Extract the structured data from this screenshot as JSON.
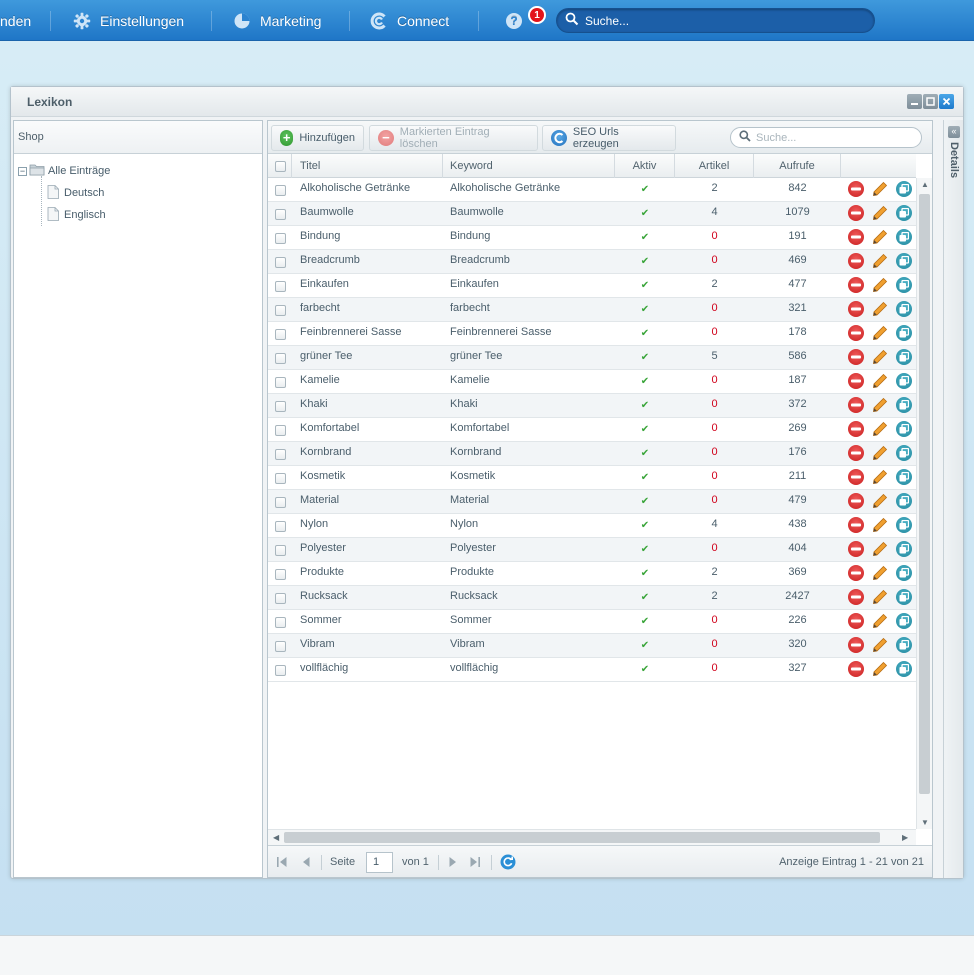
{
  "topbar": {
    "partial_label": "nden",
    "settings_label": "Einstellungen",
    "marketing_label": "Marketing",
    "connect_label": "Connect",
    "help_badge": "1",
    "search_placeholder": "Suche..."
  },
  "window": {
    "title": "Lexikon"
  },
  "left": {
    "header": "Shop",
    "tree": {
      "root": "Alle Einträge",
      "children": [
        "Deutsch",
        "Englisch"
      ]
    }
  },
  "toolbar": {
    "add_label": "Hinzufügen",
    "delete_label": "Markierten Eintrag löschen",
    "seo_label": "SEO Urls erzeugen",
    "search_placeholder": "Suche..."
  },
  "columns": {
    "title": "Titel",
    "keyword": "Keyword",
    "active": "Aktiv",
    "articles": "Artikel",
    "views": "Aufrufe"
  },
  "rows": [
    {
      "title": "Alkoholische Getränke",
      "keyword": "Alkoholische Getränke",
      "active": "✔",
      "articles": "2",
      "views": "842"
    },
    {
      "title": "Baumwolle",
      "keyword": "Baumwolle",
      "active": "✔",
      "articles": "4",
      "views": "1079"
    },
    {
      "title": "Bindung",
      "keyword": "Bindung",
      "active": "✔",
      "articles": "0",
      "views": "191"
    },
    {
      "title": "Breadcrumb",
      "keyword": "Breadcrumb",
      "active": "✔",
      "articles": "0",
      "views": "469"
    },
    {
      "title": "Einkaufen",
      "keyword": "Einkaufen",
      "active": "✔",
      "articles": "2",
      "views": "477"
    },
    {
      "title": "farbecht",
      "keyword": "farbecht",
      "active": "✔",
      "articles": "0",
      "views": "321"
    },
    {
      "title": "Feinbrennerei Sasse",
      "keyword": "Feinbrennerei Sasse",
      "active": "✔",
      "articles": "0",
      "views": "178"
    },
    {
      "title": "grüner Tee",
      "keyword": "grüner Tee",
      "active": "✔",
      "articles": "5",
      "views": "586"
    },
    {
      "title": "Kamelie",
      "keyword": "Kamelie",
      "active": "✔",
      "articles": "0",
      "views": "187"
    },
    {
      "title": "Khaki",
      "keyword": "Khaki",
      "active": "✔",
      "articles": "0",
      "views": "372"
    },
    {
      "title": "Komfortabel",
      "keyword": "Komfortabel",
      "active": "✔",
      "articles": "0",
      "views": "269"
    },
    {
      "title": "Kornbrand",
      "keyword": "Kornbrand",
      "active": "✔",
      "articles": "0",
      "views": "176"
    },
    {
      "title": "Kosmetik",
      "keyword": "Kosmetik",
      "active": "✔",
      "articles": "0",
      "views": "211"
    },
    {
      "title": "Material",
      "keyword": "Material",
      "active": "✔",
      "articles": "0",
      "views": "479"
    },
    {
      "title": "Nylon",
      "keyword": "Nylon",
      "active": "✔",
      "articles": "4",
      "views": "438"
    },
    {
      "title": "Polyester",
      "keyword": "Polyester",
      "active": "✔",
      "articles": "0",
      "views": "404"
    },
    {
      "title": "Produkte",
      "keyword": "Produkte",
      "active": "✔",
      "articles": "2",
      "views": "369"
    },
    {
      "title": "Rucksack",
      "keyword": "Rucksack",
      "active": "✔",
      "articles": "2",
      "views": "2427"
    },
    {
      "title": "Sommer",
      "keyword": "Sommer",
      "active": "✔",
      "articles": "0",
      "views": "226"
    },
    {
      "title": "Vibram",
      "keyword": "Vibram",
      "active": "✔",
      "articles": "0",
      "views": "320"
    },
    {
      "title": "vollflächig",
      "keyword": "vollflächig",
      "active": "✔",
      "articles": "0",
      "views": "327"
    }
  ],
  "pager": {
    "page_label": "Seite",
    "page_value": "1",
    "of_label": "von 1",
    "summary": "Anzeige Eintrag 1 - 21 von 21"
  },
  "details": {
    "label": "Details"
  },
  "colors": {
    "brand_blue": "#1f76c7",
    "zero_red": "#d0021b",
    "check_green": "#3aa53a"
  },
  "icons": {
    "settings": "gear-icon",
    "marketing": "pie-chart-icon",
    "connect": "connect-icon",
    "help": "help-icon",
    "search": "search-icon",
    "add": "plus-circle-icon",
    "delete": "minus-circle-icon",
    "seo": "seo-icon",
    "refresh": "refresh-icon"
  }
}
